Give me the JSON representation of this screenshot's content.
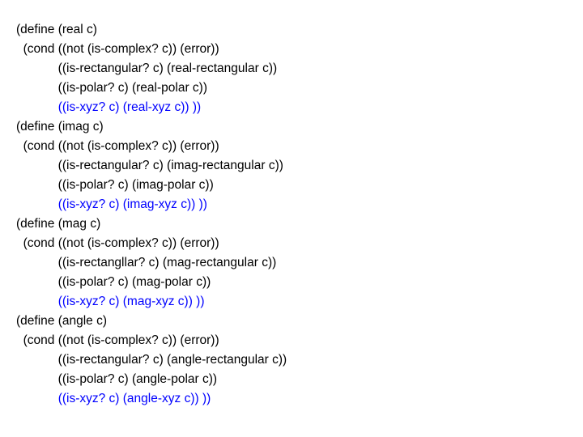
{
  "code": {
    "lines": [
      {
        "plain": "(define (real c)",
        "hl": ""
      },
      {
        "plain": "  (cond ((not (is-complex? c)) (error))",
        "hl": ""
      },
      {
        "plain": "            ((is-rectangular? c) (real-rectangular c))",
        "hl": ""
      },
      {
        "plain": "            ((is-polar? c) (real-polar c))",
        "hl": ""
      },
      {
        "plain": "            ",
        "hl": "((is-xyz? c) (real-xyz c)) ))"
      },
      {
        "plain": "(define (imag c)",
        "hl": ""
      },
      {
        "plain": "  (cond ((not (is-complex? c)) (error))",
        "hl": ""
      },
      {
        "plain": "            ((is-rectangular? c) (imag-rectangular c))",
        "hl": ""
      },
      {
        "plain": "            ((is-polar? c) (imag-polar c))",
        "hl": ""
      },
      {
        "plain": "            ",
        "hl": "((is-xyz? c) (imag-xyz c)) ))"
      },
      {
        "plain": "(define (mag c)",
        "hl": ""
      },
      {
        "plain": "  (cond ((not (is-complex? c)) (error))",
        "hl": ""
      },
      {
        "plain": "            ((is-rectangllar? c) (mag-rectangular c))",
        "hl": ""
      },
      {
        "plain": "            ((is-polar? c) (mag-polar c))",
        "hl": ""
      },
      {
        "plain": "            ",
        "hl": "((is-xyz? c) (mag-xyz c)) ))"
      },
      {
        "plain": "(define (angle c)",
        "hl": ""
      },
      {
        "plain": "  (cond ((not (is-complex? c)) (error))",
        "hl": ""
      },
      {
        "plain": "            ((is-rectangular? c) (angle-rectangular c))",
        "hl": ""
      },
      {
        "plain": "            ((is-polar? c) (angle-polar c))",
        "hl": ""
      },
      {
        "plain": "            ",
        "hl": "((is-xyz? c) (angle-xyz c)) ))"
      }
    ]
  }
}
